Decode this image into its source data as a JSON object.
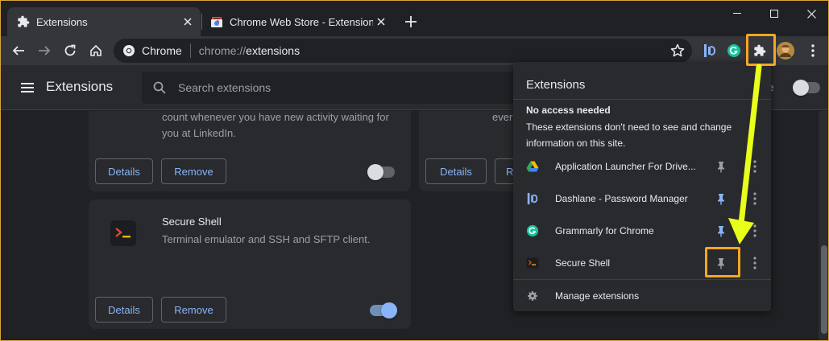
{
  "tabs": [
    {
      "title": "Extensions",
      "active": true
    },
    {
      "title": "Chrome Web Store - Extensions",
      "active": false
    }
  ],
  "toolbar": {
    "chip": "Chrome",
    "url_scheme": "chrome://",
    "url_path": "extensions"
  },
  "page": {
    "title": "Extensions",
    "search_placeholder": "Search extensions",
    "devmode_label": "de"
  },
  "cards": [
    {
      "desc_line1": "count whenever you have new activity waiting for",
      "desc_line2": "you at LinkedIn.",
      "details": "Details",
      "remove": "Remove",
      "enabled": false
    },
    {
      "desc_partial": "ever",
      "details": "Details",
      "remove_partial": "R"
    },
    {
      "name": "Secure Shell",
      "desc": "Terminal emulator and SSH and SFTP client.",
      "details": "Details",
      "remove": "Remove",
      "enabled": true
    }
  ],
  "popup": {
    "title": "Extensions",
    "section_heading": "No access needed",
    "section_desc": "These extensions don't need to see and change information on this site.",
    "items": [
      {
        "name": "Application Launcher For Drive...",
        "pinned": false
      },
      {
        "name": "Dashlane - Password Manager",
        "pinned": true
      },
      {
        "name": "Grammarly for Chrome",
        "pinned": true
      },
      {
        "name": "Secure Shell",
        "pinned": false
      }
    ],
    "manage": "Manage extensions"
  },
  "colors": {
    "highlight": "#f5a623",
    "arrow": "#e8ff1a",
    "accent": "#8ab4f8"
  }
}
